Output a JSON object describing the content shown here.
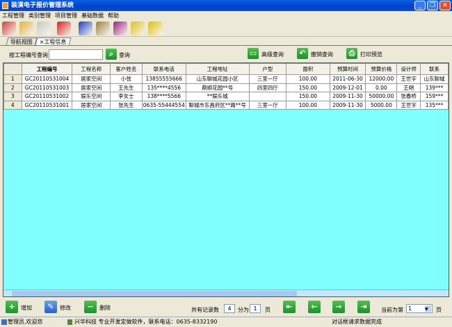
{
  "window": {
    "title": "装潢电子报价管理系统",
    "min": "_",
    "max": "❐",
    "close": "✕"
  },
  "menu": [
    "工程管理",
    "类别管理",
    "项目管理",
    "基础数据",
    "帮助"
  ],
  "toolbar_icons": [
    "users-icon",
    "folder-icon",
    "edit-doc-icon",
    "umbrella-icon",
    "alarm-clock-icon",
    "picture-icon",
    "help-book-icon",
    "gift-icon",
    "run-icon"
  ],
  "toolbar_colors": [
    "#d04040",
    "#e0b040",
    "#c8c8c0",
    "#d02020",
    "#2040c0",
    "#a08040",
    "#a02080",
    "#e0c020",
    "#e0c000"
  ],
  "tabs": [
    {
      "label": "导航视图"
    },
    {
      "label": "×工程信息"
    }
  ],
  "search": {
    "label": "按工程编号查询",
    "value": "",
    "button": "查询"
  },
  "actions": {
    "advanced": "高级查询",
    "undo": "撤销查询",
    "print": "打印预览"
  },
  "table": {
    "columns": [
      "工程编号",
      "工程名称",
      "客户姓名",
      "联系电话",
      "工程地址",
      "户型",
      "面积",
      "预算时间",
      "预算价格",
      "设计师",
      "联系"
    ],
    "rows": [
      [
        "1",
        "GC20110531004",
        "居家空间",
        "小张",
        "13855555666",
        "山东聊城花园小区",
        "三室一厅",
        "100.00",
        "2011-06-30",
        "12000.00",
        "王世宇",
        "山东聊城"
      ],
      [
        "2",
        "GC20110531003",
        "居家空间",
        "王先生",
        "135****4556",
        "鼎顺花园**号",
        "四室四厅",
        "150.00",
        "2009-12-01",
        "0.00",
        "王朔",
        "139***"
      ],
      [
        "3",
        "GC20110531002",
        "娱乐空间",
        "李女士",
        "138****5566",
        "**娱乐城",
        "",
        "150.00",
        "2009-11-30",
        "50000.00",
        "张春桥",
        "159***"
      ],
      [
        "4",
        "GC20110531001",
        "居家空间",
        "张先生",
        "0635-55444554",
        "聊城市东昌府区**路**号",
        "三室一厅",
        "100.00",
        "2009-11-30",
        "5000.00",
        "王世宇",
        "135***"
      ]
    ]
  },
  "bottom": {
    "add": "增加",
    "edit": "修改",
    "delete": "删除",
    "total_label": "共有记录数",
    "total": "4",
    "pages_label": "分为",
    "pages": "1",
    "page_unit": "页",
    "current_label": "当前为第",
    "current": "1",
    "current_unit": "页"
  },
  "status": {
    "user": "管理员,欢迎您",
    "company": "兴华科技 专业开发定做软件，联系电话：0635-8332190",
    "message": "对话框请求数据完成"
  }
}
